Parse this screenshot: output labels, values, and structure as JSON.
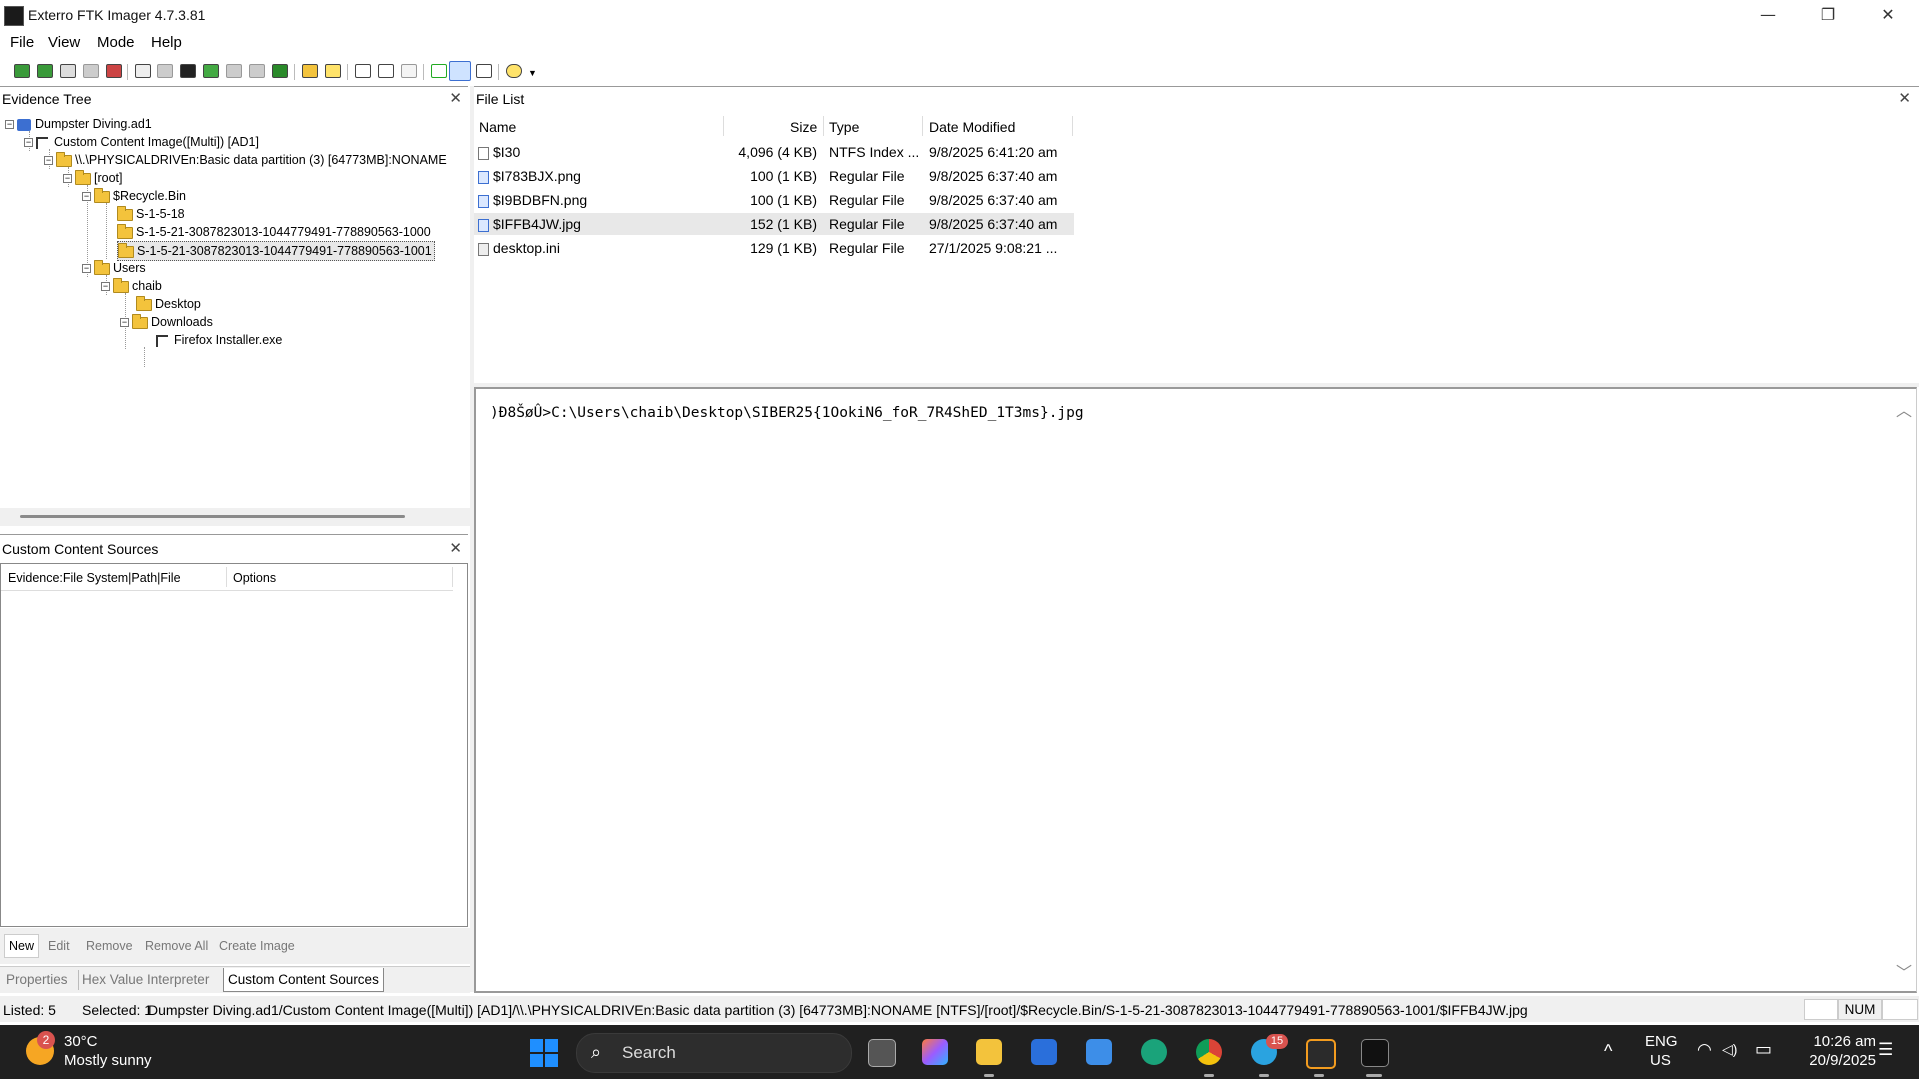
{
  "window": {
    "title": "Exterro FTK Imager 4.7.3.81",
    "minimize_glyph": "—",
    "maximize_glyph": "❐",
    "close_glyph": "✕"
  },
  "menu": [
    "File",
    "View",
    "Mode",
    "Help"
  ],
  "evidence_tree": {
    "title": "Evidence Tree",
    "close_glyph": "✕",
    "nodes": [
      "Dumpster Diving.ad1",
      "Custom Content Image([Multi]) [AD1]",
      "\\\\.\\PHYSICALDRIVEn:Basic data partition (3) [64773MB]:NONAME",
      "[root]",
      "$Recycle.Bin",
      "S-1-5-18",
      "S-1-5-21-3087823013-1044779491-778890563-1000",
      "S-1-5-21-3087823013-1044779491-778890563-1001",
      "Users",
      "chaib",
      "Desktop",
      "Downloads",
      "Firefox Installer.exe"
    ]
  },
  "file_list": {
    "title": "File List",
    "close_glyph": "✕",
    "columns": [
      "Name",
      "Size",
      "Type",
      "Date Modified"
    ],
    "rows": [
      {
        "name": "$I30",
        "size": "4,096 (4 KB)",
        "type": "NTFS Index ...",
        "date": "9/8/2025 6:41:20 am",
        "icon": "file-icon"
      },
      {
        "name": "$I783BJX.png",
        "size": "100 (1 KB)",
        "type": "Regular File",
        "date": "9/8/2025 6:37:40 am",
        "icon": "recycle-file-icon"
      },
      {
        "name": "$I9BDBFN.png",
        "size": "100 (1 KB)",
        "type": "Regular File",
        "date": "9/8/2025 6:37:40 am",
        "icon": "recycle-file-icon"
      },
      {
        "name": "$IFFB4JW.jpg",
        "size": "152 (1 KB)",
        "type": "Regular File",
        "date": "9/8/2025 6:37:40 am",
        "icon": "recycle-file-icon"
      },
      {
        "name": "desktop.ini",
        "size": "129 (1 KB)",
        "type": "Regular File",
        "date": "27/1/2025 9:08:21 ...",
        "icon": "ini-file-icon"
      }
    ]
  },
  "viewer": {
    "content": ")Ð8ŠøÛ>C:\\Users\\chaib\\Desktop\\SIBER25{1OokiN6_foR_7R4ShED_1T3ms}.jpg",
    "scroll_up_glyph": "︿",
    "scroll_down_glyph": "﹀"
  },
  "custom_content": {
    "title": "Custom Content Sources",
    "close_glyph": "✕",
    "columns": [
      "Evidence:File System|Path|File",
      "Options"
    ],
    "buttons": [
      "New",
      "Edit",
      "Remove",
      "Remove All",
      "Create Image"
    ]
  },
  "bottom_tabs": [
    "Properties",
    "Hex Value Interpreter",
    "Custom Content Sources"
  ],
  "statusbar": {
    "listed": "Listed: 5",
    "selected": "Selected: 1",
    "path": "Dumpster Diving.ad1/Custom Content Image([Multi]) [AD1]/\\\\.\\PHYSICALDRIVEn:Basic data partition (3) [64773MB]:NONAME [NTFS]/[root]/$Recycle.Bin/S-1-5-21-3087823013-1044779491-778890563-1001/$IFFB4JW.jpg",
    "num": "NUM"
  },
  "taskbar": {
    "weather_badge": "2",
    "temperature": "30°C",
    "weather": "Mostly sunny",
    "search_placeholder": "Search",
    "telegram_badge": "15",
    "lang_primary": "ENG",
    "lang_secondary": "US",
    "time": "10:26 am",
    "date": "20/9/2025",
    "tray_up_glyph": "^",
    "wifi_glyph": "◠",
    "volume_glyph": "◁)",
    "battery_glyph": "▭",
    "notif_glyph": "☰"
  },
  "colors": {
    "taskbar_bg": "#202020",
    "selection": "#e8e8e8",
    "folder": "#f3c33c",
    "windows_blue": "#1f8fff"
  }
}
